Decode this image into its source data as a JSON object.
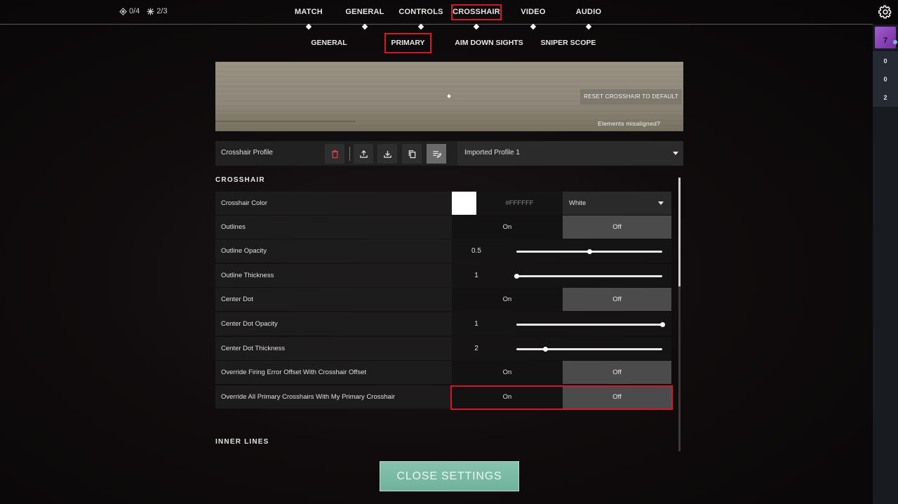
{
  "header": {
    "stats": [
      {
        "icon": "diamond-icon",
        "value": "0/4"
      },
      {
        "icon": "sun-icon",
        "value": "2/3"
      }
    ],
    "tabs": [
      {
        "label": "MATCH"
      },
      {
        "label": "GENERAL"
      },
      {
        "label": "CONTROLS"
      },
      {
        "label": "CROSSHAIR",
        "active": true
      },
      {
        "label": "VIDEO"
      },
      {
        "label": "AUDIO"
      }
    ],
    "settings_icon": "gear-icon"
  },
  "subtabs": [
    {
      "label": "GENERAL"
    },
    {
      "label": "PRIMARY",
      "active": true
    },
    {
      "label": "AIM DOWN SIGHTS"
    },
    {
      "label": "SNIPER SCOPE"
    }
  ],
  "sidebar": {
    "avatar_number": "7",
    "scores": [
      "0",
      "0",
      "2"
    ]
  },
  "preview": {
    "reset_label": "RESET CROSSHAIR TO DEFAULT",
    "misaligned_label": "Elements misaligned?"
  },
  "profile": {
    "label": "Crosshair Profile",
    "buttons": [
      "delete-icon",
      "upload-icon",
      "download-icon",
      "copy-icon",
      "edit-icon"
    ],
    "selected": "Imported Profile 1"
  },
  "crosshair_section": {
    "title": "CROSSHAIR",
    "color": {
      "label": "Crosshair Color",
      "hex": "#FFFFFF",
      "name": "White",
      "swatch": "#ffffff"
    },
    "outlines": {
      "label": "Outlines",
      "on": "On",
      "off": "Off",
      "value": "Off"
    },
    "outline_opacity": {
      "label": "Outline Opacity",
      "value": "0.5",
      "fraction": 0.5
    },
    "outline_thickness": {
      "label": "Outline Thickness",
      "value": "1",
      "fraction": 0.0
    },
    "center_dot": {
      "label": "Center Dot",
      "on": "On",
      "off": "Off",
      "value": "Off"
    },
    "center_dot_opacity": {
      "label": "Center Dot Opacity",
      "value": "1",
      "fraction": 1.0
    },
    "center_dot_thickness": {
      "label": "Center Dot Thickness",
      "value": "2",
      "fraction": 0.2
    },
    "override_firing_error": {
      "label": "Override Firing Error Offset With Crosshair Offset",
      "on": "On",
      "off": "Off",
      "value": "Off"
    },
    "override_all_primary": {
      "label": "Override All Primary Crosshairs With My Primary Crosshair",
      "on": "On",
      "off": "Off",
      "value": "Off"
    }
  },
  "inner_lines_section": {
    "title": "INNER LINES"
  },
  "footer": {
    "close_label": "CLOSE SETTINGS"
  },
  "colors": {
    "accent_red": "#d6162a",
    "close_button": "#7fbfa9"
  }
}
